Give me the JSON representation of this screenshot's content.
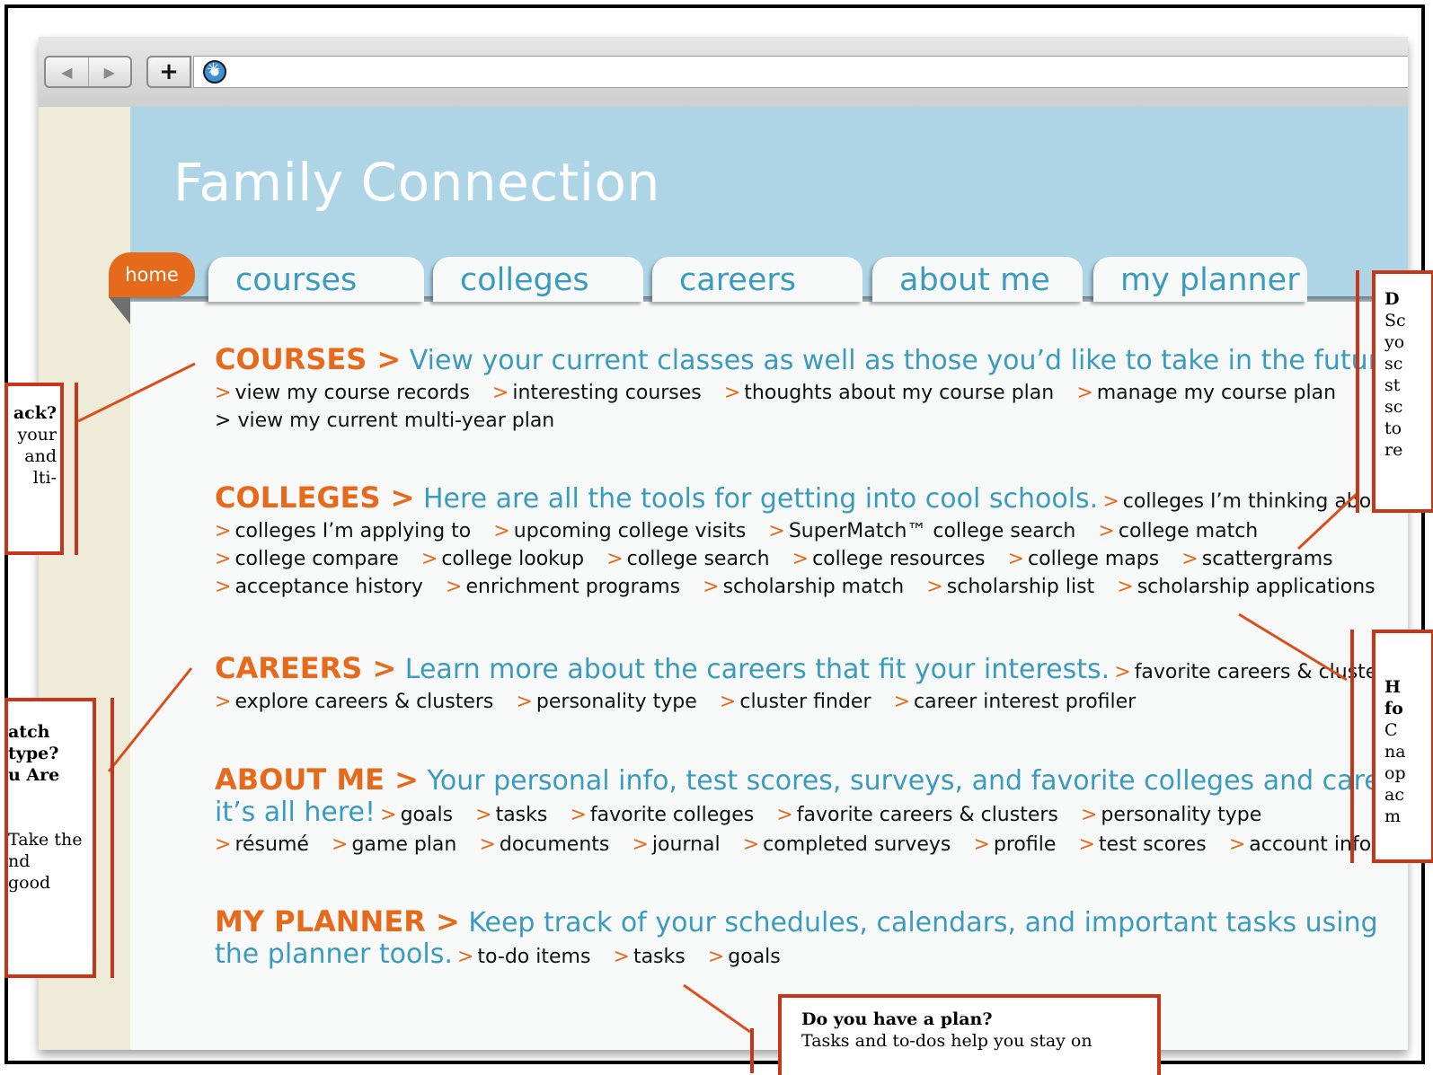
{
  "browser": {
    "back_icon": "back-arrow-icon",
    "forward_icon": "forward-arrow-icon",
    "new_tab_label": "+",
    "site_icon": "compass-globe-icon"
  },
  "site": {
    "title": "Family Connection",
    "home_label": "home",
    "tabs": [
      "courses",
      "colleges",
      "careers",
      "about me",
      "my planner"
    ]
  },
  "sections": {
    "courses": {
      "title": "COURSES >",
      "desc": " View your current classes as well as those you’d like to take in the future.",
      "links": [
        "view my course records",
        "interesting courses",
        "thoughts about my course plan",
        "manage my course plan",
        "view my current multi-year plan"
      ]
    },
    "colleges": {
      "title": "COLLEGES >",
      "desc": " Here are all the tools for getting into cool schools.",
      "links": [
        "colleges I’m thinking about",
        "colleges I’m applying to",
        "upcoming college visits",
        "SuperMatch™ college search",
        "college match",
        "college compare",
        "college lookup",
        "college search",
        "college resources",
        "college maps",
        "scattergrams",
        "acceptance history",
        "enrichment programs",
        "scholarship match",
        "scholarship list",
        "scholarship applications"
      ]
    },
    "careers": {
      "title": "CAREERS >",
      "desc": " Learn more about the careers that fit your interests.",
      "links": [
        "favorite careers & clusters",
        "explore careers & clusters",
        "personality type",
        "cluster finder",
        "career interest profiler"
      ]
    },
    "aboutme": {
      "title": "ABOUT ME >",
      "desc": " Your personal info, test scores, surveys, and favorite colleges and careers—",
      "desc2": "it’s all here!",
      "links": [
        "goals",
        "tasks",
        "favorite colleges",
        "favorite careers & clusters",
        "personality type",
        "résumé",
        "game plan",
        "documents",
        "journal",
        "completed surveys",
        "profile",
        "test scores",
        "account info"
      ]
    },
    "planner": {
      "title": "MY PLANNER >",
      "desc": " Keep track of your schedules, calendars, and important tasks using",
      "desc2": "the planner tools.",
      "links": [
        "to-do items",
        "tasks",
        "goals"
      ]
    }
  },
  "link_prefix": ">",
  "notes": {
    "left1": {
      "title": "ack?",
      "lines": [
        "your",
        "and",
        "lti-"
      ]
    },
    "left2": {
      "title_lines": [
        "atch",
        "type?",
        "u Are"
      ],
      "lines": [
        "Take the",
        "nd",
        "good"
      ]
    },
    "right1": {
      "title": "D",
      "lines": [
        "Sc",
        "yo",
        "sc",
        "st",
        "sc",
        "to",
        "re"
      ]
    },
    "right2": {
      "title_lines": [
        "H",
        "fo"
      ],
      "lines": [
        "C",
        "na",
        "op",
        "ac",
        "m"
      ]
    },
    "bottom": {
      "title": "Do you have a plan?",
      "line": "Tasks and to-dos help you stay on"
    }
  }
}
